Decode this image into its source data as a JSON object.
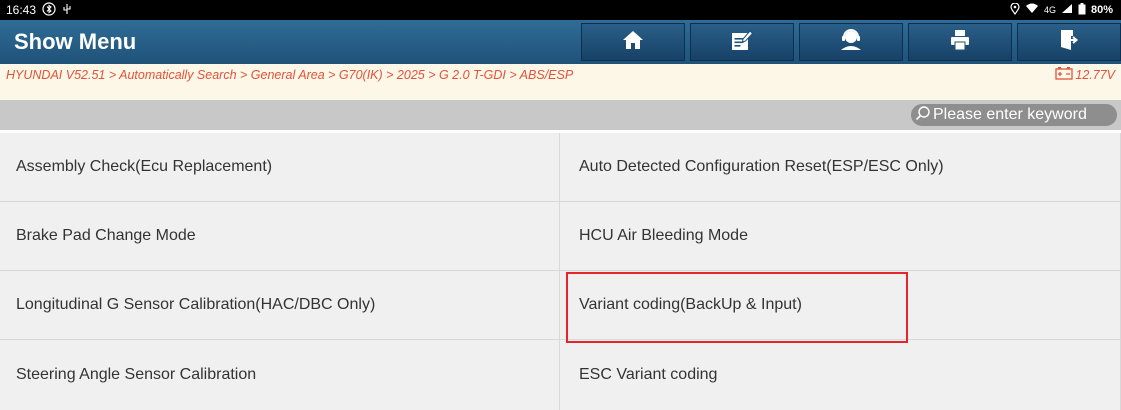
{
  "status_bar": {
    "time": "16:43",
    "network": "4G",
    "battery": "80%"
  },
  "header": {
    "title": "Show Menu",
    "buttons": [
      {
        "icon": "home-icon"
      },
      {
        "icon": "edit-icon"
      },
      {
        "icon": "user-support-icon"
      },
      {
        "icon": "print-icon"
      },
      {
        "icon": "exit-icon"
      }
    ]
  },
  "breadcrumb": {
    "path": "HYUNDAI V52.51 > Automatically Search > General Area > G70(IK) > 2025 > G 2.0 T-GDI > ABS/ESP",
    "voltage": "12.77V"
  },
  "search": {
    "placeholder": "Please enter keyword"
  },
  "menu": {
    "items": [
      "Assembly Check(Ecu Replacement)",
      "Auto Detected Configuration Reset(ESP/ESC Only)",
      "Brake Pad Change Mode",
      "HCU Air Bleeding Mode",
      "Longitudinal G Sensor Calibration(HAC/DBC Only)",
      "Variant coding(BackUp & Input)",
      "Steering Angle Sensor Calibration",
      "ESC Variant coding"
    ],
    "highlighted_index": 5
  },
  "colors": {
    "header": "#1f5279",
    "breadcrumb_text": "#e2523a",
    "highlight_border": "#e4252b"
  }
}
